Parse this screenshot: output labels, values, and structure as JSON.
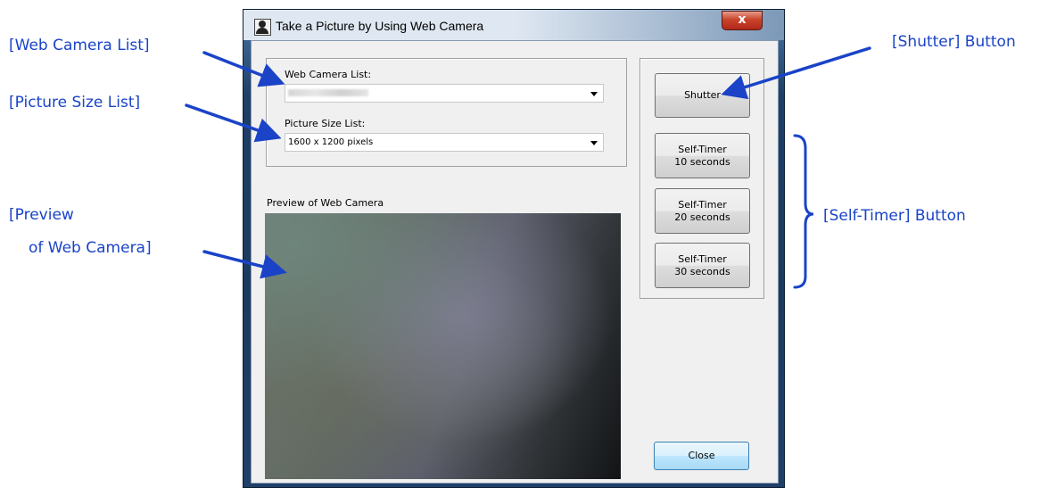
{
  "window": {
    "title": "Take a Picture by Using Web Camera",
    "close_glyph": "x"
  },
  "camera_group": {
    "web_camera_label": "Web Camera List:",
    "web_camera_value": "",
    "picture_size_label": "Picture Size List:",
    "picture_size_value": "1600 x 1200 pixels"
  },
  "preview": {
    "label": "Preview of Web Camera"
  },
  "buttons": {
    "shutter": "Shutter",
    "self_timer_10_line1": "Self-Timer",
    "self_timer_10_line2": "10 seconds",
    "self_timer_20_line1": "Self-Timer",
    "self_timer_20_line2": "20 seconds",
    "self_timer_30_line1": "Self-Timer",
    "self_timer_30_line2": "30 seconds",
    "close": "Close"
  },
  "annotations": {
    "web_camera_list": "[Web Camera List]",
    "picture_size_list": "[Picture Size List]",
    "preview_line1": "[Preview",
    "preview_line2": "of Web Camera]",
    "shutter_button": "[Shutter] Button",
    "self_timer_button": "[Self-Timer] Button"
  },
  "colors": {
    "annotation_blue": "#1a43c8",
    "close_button_red": "#c9442c"
  },
  "icons": [
    "user-silhouette-icon",
    "dropdown-arrow-icon"
  ]
}
